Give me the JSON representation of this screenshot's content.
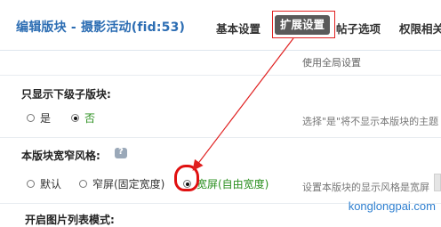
{
  "header": {
    "title": "编辑版块 - 摄影活动(fid:53)",
    "tabs": [
      {
        "label": "基本设置"
      },
      {
        "label": "扩展设置",
        "active": true
      },
      {
        "label": "帖子选项"
      },
      {
        "label": "权限相关"
      }
    ]
  },
  "global_hint": "使用全局设置",
  "sections": [
    {
      "title": "只显示下级子版块:",
      "options": [
        {
          "label": "是",
          "selected": false
        },
        {
          "label": "否",
          "selected": true
        }
      ],
      "description": "选择\"是\"将不显示本版块的主题"
    },
    {
      "title": "本版块宽窄风格:",
      "options": [
        {
          "label": "默认",
          "selected": false
        },
        {
          "label": "窄屏(固定宽度)",
          "selected": false
        },
        {
          "label": "宽屏(自由宽度)",
          "selected": true
        }
      ],
      "description": "设置本版块的显示风格是宽屏"
    },
    {
      "title": "开启图片列表模式:"
    }
  ],
  "watermark": "konglongpai.com",
  "colors": {
    "title_blue": "#2c6db3",
    "active_tab_bg": "#5a5a5a",
    "annotation_red": "#e02020",
    "selected_green": "#2a8f1e"
  }
}
